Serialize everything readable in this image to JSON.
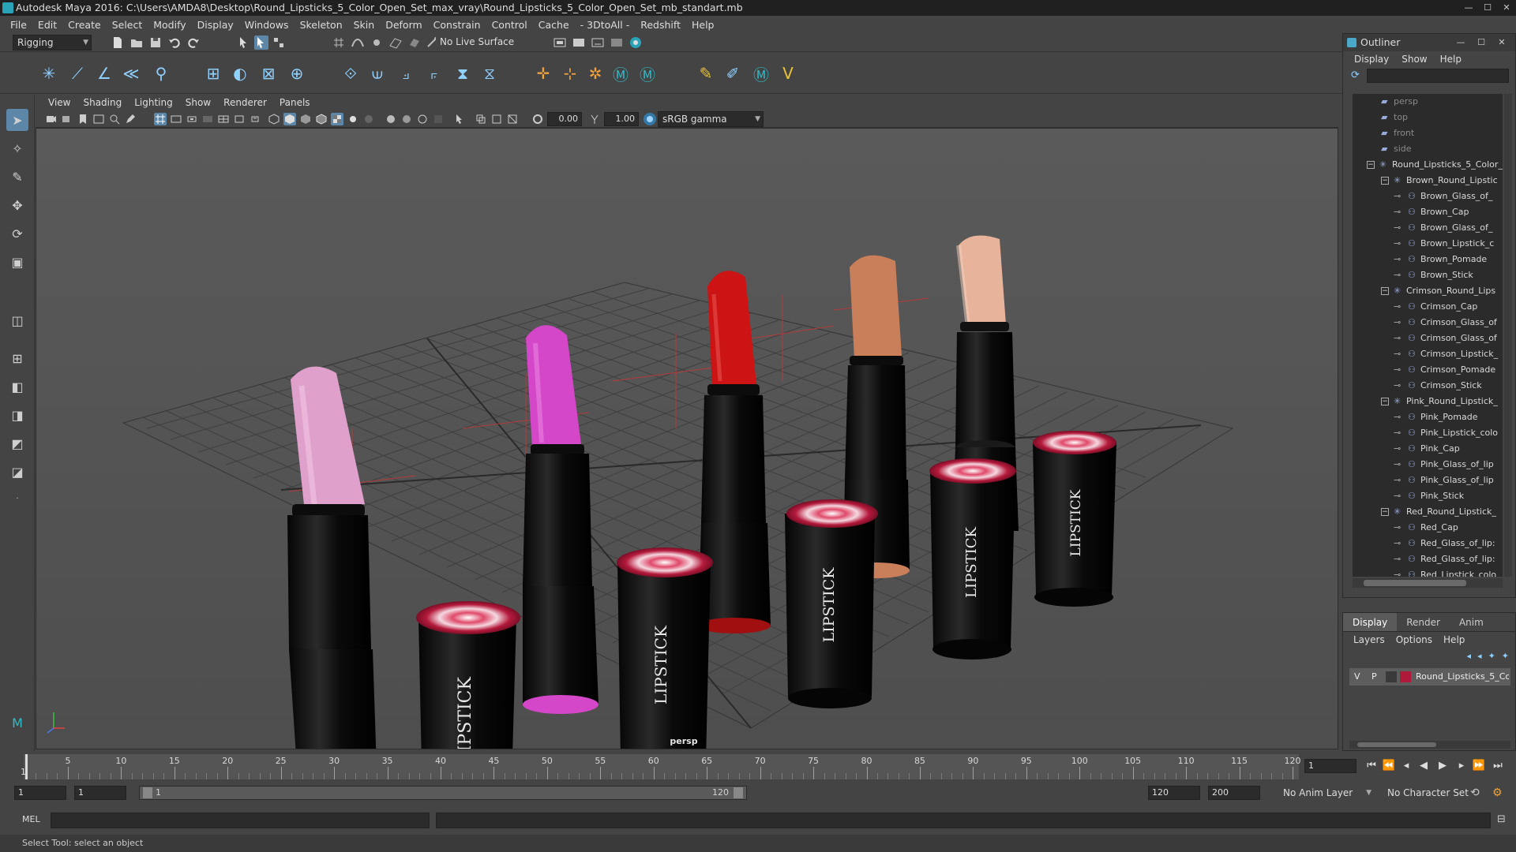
{
  "window": {
    "title": "Autodesk Maya 2016: C:\\Users\\AMDA8\\Desktop\\Round_Lipsticks_5_Color_Open_Set_max_vray\\Round_Lipsticks_5_Color_Open_Set_mb_standart.mb"
  },
  "menubar": [
    "File",
    "Edit",
    "Create",
    "Select",
    "Modify",
    "Display",
    "Windows",
    "Skeleton",
    "Skin",
    "Deform",
    "Constrain",
    "Control",
    "Cache",
    "- 3DtoAll -",
    "Redshift",
    "Help"
  ],
  "statusline": {
    "mode": "Rigging",
    "live_surface": "No Live Surface"
  },
  "panel": {
    "menu": [
      "View",
      "Shading",
      "Lighting",
      "Show",
      "Renderer",
      "Panels"
    ],
    "exposure": "0.00",
    "gamma": "1.00",
    "color_space": "sRGB gamma",
    "camera_label": "persp"
  },
  "outliner": {
    "title": "Outliner",
    "menu": [
      "Display",
      "Show",
      "Help"
    ],
    "items": [
      {
        "label": "persp",
        "type": "camera"
      },
      {
        "label": "top",
        "type": "camera"
      },
      {
        "label": "front",
        "type": "camera"
      },
      {
        "label": "side",
        "type": "camera"
      },
      {
        "label": "Round_Lipsticks_5_Color_",
        "type": "group",
        "depth": 0
      },
      {
        "label": "Brown_Round_Lipstic",
        "type": "group",
        "depth": 1
      },
      {
        "label": "Brown_Glass_of_",
        "type": "mesh"
      },
      {
        "label": "Brown_Cap",
        "type": "mesh"
      },
      {
        "label": "Brown_Glass_of_",
        "type": "mesh"
      },
      {
        "label": "Brown_Lipstick_c",
        "type": "mesh"
      },
      {
        "label": "Brown_Pomade",
        "type": "mesh"
      },
      {
        "label": "Brown_Stick",
        "type": "mesh"
      },
      {
        "label": "Crimson_Round_Lips",
        "type": "group",
        "depth": 1
      },
      {
        "label": "Crimson_Cap",
        "type": "mesh"
      },
      {
        "label": "Crimson_Glass_of",
        "type": "mesh"
      },
      {
        "label": "Crimson_Glass_of",
        "type": "mesh"
      },
      {
        "label": "Crimson_Lipstick_",
        "type": "mesh"
      },
      {
        "label": "Crimson_Pomade",
        "type": "mesh"
      },
      {
        "label": "Crimson_Stick",
        "type": "mesh"
      },
      {
        "label": "Pink_Round_Lipstick_",
        "type": "group",
        "depth": 1
      },
      {
        "label": "Pink_Pomade",
        "type": "mesh"
      },
      {
        "label": "Pink_Lipstick_colo",
        "type": "mesh"
      },
      {
        "label": "Pink_Cap",
        "type": "mesh"
      },
      {
        "label": "Pink_Glass_of_lip",
        "type": "mesh"
      },
      {
        "label": "Pink_Glass_of_lip",
        "type": "mesh"
      },
      {
        "label": "Pink_Stick",
        "type": "mesh"
      },
      {
        "label": "Red_Round_Lipstick_",
        "type": "group",
        "depth": 1
      },
      {
        "label": "Red_Cap",
        "type": "mesh"
      },
      {
        "label": "Red_Glass_of_lip:",
        "type": "mesh"
      },
      {
        "label": "Red_Glass_of_lip:",
        "type": "mesh"
      },
      {
        "label": "Red_Lipstick_colo",
        "type": "mesh"
      }
    ]
  },
  "layers": {
    "tabs": [
      "Display",
      "Render",
      "Anim"
    ],
    "menu": [
      "Layers",
      "Options",
      "Help"
    ],
    "row": {
      "v": "V",
      "p": "P",
      "name": "Round_Lipsticks_5_Co",
      "color": "#b01a3a"
    }
  },
  "timeline": {
    "ticks": [
      5,
      10,
      15,
      20,
      25,
      30,
      35,
      40,
      45,
      50,
      55,
      60,
      65,
      70,
      75,
      80,
      85,
      90,
      95,
      100,
      105,
      110,
      115,
      120
    ],
    "start_label": "1",
    "current_frame": "1"
  },
  "range": {
    "start": "1",
    "playback_start": "1",
    "slider_start": "1",
    "slider_end": "120",
    "playback_end": "120",
    "end": "200",
    "anim_layer": "No Anim Layer",
    "character_set": "No Character Set"
  },
  "cmdline": {
    "label": "MEL"
  },
  "helpline": {
    "text": "Select Tool: select an object"
  },
  "viewport_text": {
    "word": "LIPSTICK"
  },
  "colors": {
    "pink": "#e0a0cc",
    "magenta": "#d447c9",
    "red": "#cc1414",
    "tan": "#c97f5a",
    "nude": "#e8b39b"
  }
}
